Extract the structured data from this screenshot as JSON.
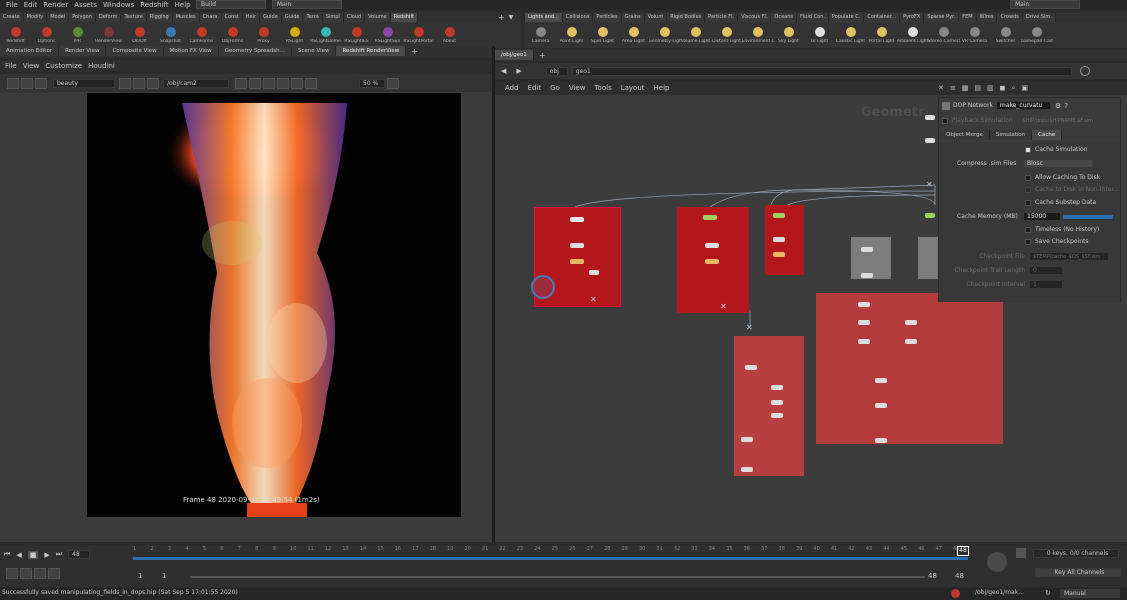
{
  "menubar": {
    "items": [
      "File",
      "Edit",
      "Render",
      "Assets",
      "Windows",
      "Redshift",
      "Help"
    ],
    "desktop_left": "Build",
    "desktop_mid": "Main",
    "desktop_right": "Main"
  },
  "shelf_left": {
    "tabs": [
      "Create",
      "Modify",
      "Model",
      "Polygon",
      "Deform",
      "Texture",
      "Rigging",
      "Muscles",
      "Chara",
      "Const",
      "Hair",
      "Guide",
      "Guide",
      "Terra",
      "Simpl",
      "Cloud",
      "Volume",
      "Redshift"
    ],
    "tools": [
      {
        "label": "Redshift",
        "color": "#c0392b"
      },
      {
        "label": "Options",
        "color": "#c0392b"
      },
      {
        "label": "IPR",
        "color": "#5a8a3a"
      },
      {
        "label": "RenderView",
        "color": "#7a3a3a"
      },
      {
        "label": "On/Off",
        "color": "#c0392b"
      },
      {
        "label": "Snapshot",
        "color": "#3a7ab8"
      },
      {
        "label": "CamForms",
        "color": "#c0392b"
      },
      {
        "label": "ObjForms",
        "color": "#c0392b"
      },
      {
        "label": "Proxy",
        "color": "#c0392b"
      },
      {
        "label": "RSLight",
        "color": "#d4ac0d"
      },
      {
        "label": "RSLightDome",
        "color": "#3ab8b8"
      },
      {
        "label": "RSLightIES",
        "color": "#c0392b"
      },
      {
        "label": "RSLightSun",
        "color": "#8e44ad"
      },
      {
        "label": "RSLightPortal",
        "color": "#c0392b"
      },
      {
        "label": "About",
        "color": "#c0392b"
      }
    ]
  },
  "shelf_right": {
    "tabs": [
      "Lights and...",
      "Collisions",
      "Particles",
      "Grains",
      "Volum",
      "Rigid Bodies",
      "Particle Fl.",
      "Viscous Fl.",
      "Oceans",
      "Fluid Con.",
      "Populate C.",
      "Container...",
      "PyroFX",
      "Sparse Pyr.",
      "FEM",
      "Wires",
      "Crowds",
      "Drive Sim."
    ],
    "tools": [
      {
        "label": "Camera",
        "color": "#888"
      },
      {
        "label": "Point Light",
        "color": "#e0c060"
      },
      {
        "label": "Spot Light",
        "color": "#e0c060"
      },
      {
        "label": "Area Light",
        "color": "#e0c060"
      },
      {
        "label": "Geometry Light",
        "color": "#e0c060"
      },
      {
        "label": "Volume Light",
        "color": "#e0c060"
      },
      {
        "label": "Distant Light",
        "color": "#e0c060"
      },
      {
        "label": "Environment Light",
        "color": "#e0c060"
      },
      {
        "label": "Sky Light",
        "color": "#e0c060"
      },
      {
        "label": "GI Light",
        "color": "#ddd"
      },
      {
        "label": "Caustic Light",
        "color": "#e0c060"
      },
      {
        "label": "Portal Light",
        "color": "#e0c060"
      },
      {
        "label": "Ambient Light",
        "color": "#ddd"
      },
      {
        "label": "Stereo Camera",
        "color": "#888"
      },
      {
        "label": "VR Camera",
        "color": "#888"
      },
      {
        "label": "Switcher",
        "color": "#888"
      },
      {
        "label": "Gamepad Camera",
        "color": "#888"
      }
    ]
  },
  "left_panel": {
    "tabs": [
      "Animation Editor",
      "Render View",
      "Composite View",
      "Motion FX View",
      "Geometry Spreadsh...",
      "Scene View",
      "Redshift RenderView"
    ],
    "menu": [
      "File",
      "View",
      "Customize",
      "Houdini"
    ],
    "aov": "beauty",
    "camera": "/obj/cam2",
    "zoom": "50 %",
    "frame_caption": "Frame  48  2020-09-05  16:49:54  (1m2s)"
  },
  "right_panel": {
    "path_tab": "/obj/geo1",
    "path_obj": "obj",
    "path_geo": "geo1",
    "menu": [
      "Add",
      "Edit",
      "Go",
      "View",
      "Tools",
      "Layout",
      "Help"
    ],
    "watermark": "Geometr",
    "params": {
      "type_label": "DOP Network",
      "name_value": "make_curvatu",
      "playback_label": "Playback Simulation",
      "playback_value": "$HIP/dops/$HIPNAME.$F.sim",
      "tabs": [
        "Object Merge",
        "Simulation",
        "Cache"
      ],
      "cache_simulation": "Cache Simulation",
      "compress_label": "Compress .sim Files",
      "compress_value": "Blosc",
      "allow_caching": "Allow Caching To Disk",
      "cache_nonint": "Cache to Disk in Non-Inter...",
      "cache_substep": "Cache Substep Data",
      "cache_mem_label": "Cache Memory (MB)",
      "cache_mem_value": "15000",
      "timeless": "Timeless (No History)",
      "save_chk": "Save Checkpoints",
      "chk_file_label": "Checkpoint File",
      "chk_file_value": "$TEMP/cache_$OS_$SF.sim",
      "chk_trail_label": "Checkpoint Trail Length",
      "chk_trail_value": "0",
      "chk_interval_label": "Checkpoint Interval",
      "chk_interval_value": "1"
    }
  },
  "timeline": {
    "current_frame": "48",
    "ticks": [
      "1",
      "2",
      "3",
      "4",
      "5",
      "6",
      "7",
      "8",
      "9",
      "10",
      "11",
      "12",
      "13",
      "14",
      "15",
      "16",
      "17",
      "18",
      "19",
      "20",
      "21",
      "22",
      "23",
      "24",
      "25",
      "26",
      "27",
      "28",
      "29",
      "30",
      "31",
      "32",
      "33",
      "34",
      "35",
      "36",
      "37",
      "38",
      "39",
      "40",
      "41",
      "42",
      "43",
      "44",
      "45",
      "46",
      "47",
      "48"
    ],
    "range_start": "1",
    "range_start2": "1",
    "range_end": "48",
    "range_end2": "48",
    "keys_label": "0 keys, 0/0 channels",
    "key_all": "Key All Channels"
  },
  "status": {
    "message": "Successfully saved manipulating_fields_in_dops.hip (Sat Sep  5 17:01:55 2020)",
    "path": "/obj/geo1/mak...",
    "mode": "Manual"
  }
}
